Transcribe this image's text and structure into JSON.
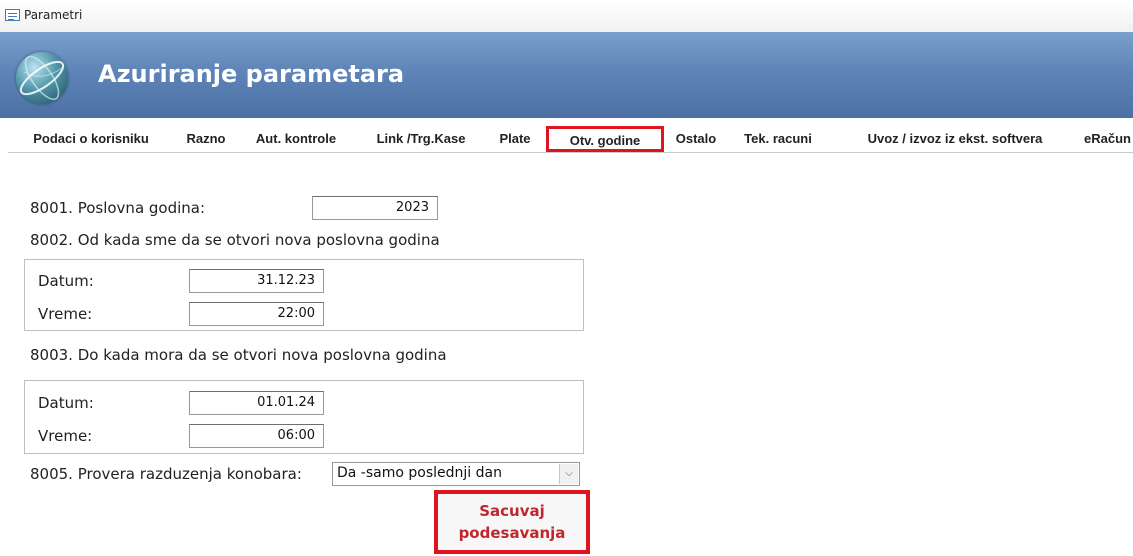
{
  "window": {
    "title": "Parametri"
  },
  "header": {
    "title": "Azuriranje parametara"
  },
  "tabs": [
    {
      "label": "Podaci o korisniku",
      "active": false
    },
    {
      "label": "Razno",
      "active": false
    },
    {
      "label": "Aut. kontrole",
      "active": false
    },
    {
      "label": "Link /Trg.Kase",
      "active": false
    },
    {
      "label": "Plate",
      "active": false
    },
    {
      "label": "Otv. godine",
      "active": true
    },
    {
      "label": "Ostalo",
      "active": false
    },
    {
      "label": "Tek. racuni",
      "active": false
    },
    {
      "label": "Uvoz / izvoz iz ekst. softvera",
      "active": false
    },
    {
      "label": "eRačun",
      "active": false
    }
  ],
  "form": {
    "p8001": {
      "label": "8001. Poslovna godina:",
      "value": "2023"
    },
    "p8002": {
      "label": "8002. Od kada sme da se otvori nova poslovna godina",
      "datum_label": "Datum:",
      "datum": "31.12.23",
      "vreme_label": "Vreme:",
      "vreme": "22:00"
    },
    "p8003": {
      "label": "8003. Do kada mora da se otvori nova poslovna godina",
      "datum_label": "Datum:",
      "datum": "01.01.24",
      "vreme_label": "Vreme:",
      "vreme": "06:00"
    },
    "p8005": {
      "label": "8005. Provera razduzenja konobara:",
      "value": "Da -samo poslednji dan"
    }
  },
  "save_button": {
    "line1": "Sacuvaj",
    "line2": "podesavanja"
  },
  "colors": {
    "header": "#5f85b8",
    "highlight": "#e0141e",
    "button_text": "#c0262d"
  }
}
